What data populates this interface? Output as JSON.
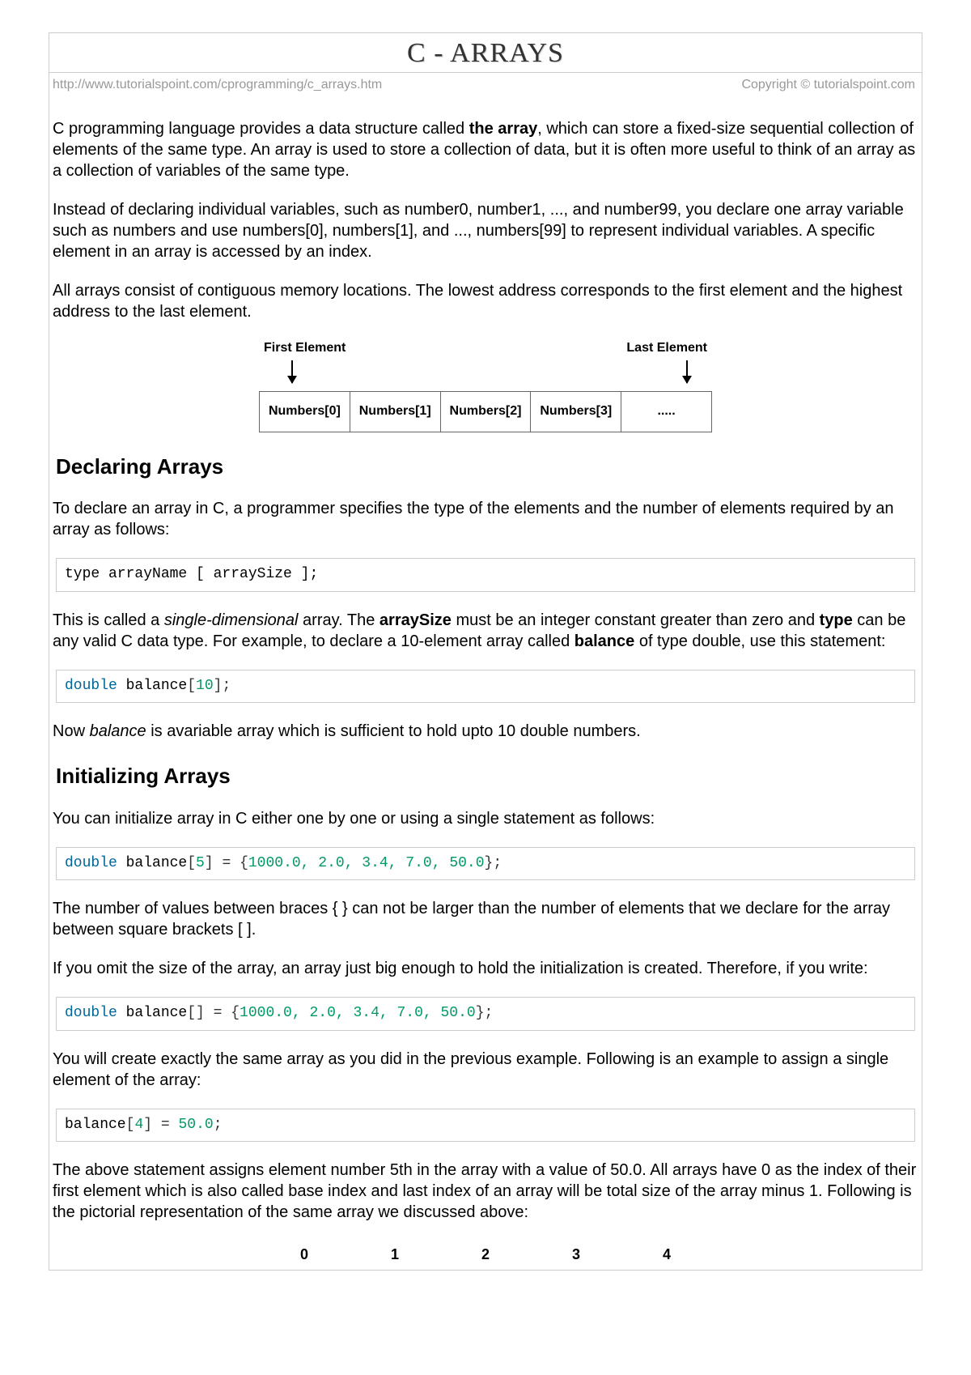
{
  "title": "C - ARRAYS",
  "url": "http://www.tutorialspoint.com/cprogramming/c_arrays.htm",
  "copyright": "Copyright © tutorialspoint.com",
  "para1_a": "C programming language provides a data structure called ",
  "para1_b": "the array",
  "para1_c": ", which can store a fixed-size sequential collection of elements of the same type. An array is used to store a collection of data, but it is often more useful to think of an array as a collection of variables of the same type.",
  "para2": "Instead of declaring individual variables, such as number0, number1, ..., and number99, you declare one array variable such as numbers and use numbers[0], numbers[1], and ..., numbers[99] to represent individual variables. A specific element in an array is accessed by an index.",
  "para3": "All arrays consist of contiguous memory locations. The lowest address corresponds to the first element and the highest address to the last element.",
  "diag1": {
    "first": "First Element",
    "last": "Last Element",
    "cells": [
      "Numbers[0]",
      "Numbers[1]",
      "Numbers[2]",
      "Numbers[3]",
      "....."
    ]
  },
  "h_declaring": "Declaring Arrays",
  "para4": "To declare an array in C, a programmer specifies the type of the elements and the number of elements required by an array as follows:",
  "code1": "type arrayName [ arraySize ];",
  "para5_a": "This is called a ",
  "para5_b": "single-dimensional",
  "para5_c": " array. The ",
  "para5_d": "arraySize",
  "para5_e": " must be an integer constant greater than zero and ",
  "para5_f": "type",
  "para5_g": " can be any valid C data type. For example, to declare a 10-element array called ",
  "para5_h": "balance",
  "para5_i": " of type double, use this statement:",
  "code2_kw": "double",
  "code2_rest": " balance",
  "code2_num": "10",
  "para6_a": "Now ",
  "para6_b": "balance",
  "para6_c": " is avariable array which is sufficient to hold upto 10 double numbers.",
  "h_init": "Initializing Arrays",
  "para7": "You can initialize array in C either one by one or using a single statement as follows:",
  "code3_kw": "double",
  "code3_a": " balance",
  "code3_n1": "5",
  "code3_vals": "1000.0, 2.0, 3.4, 7.0, 50.0",
  "para8": "The number of values between braces { } can not be larger than the number of elements that we declare for the array between square brackets [ ].",
  "para9": "If you omit the size of the array, an array just big enough to hold the initialization is created. Therefore, if you write:",
  "code4_kw": "double",
  "code4_a": " balance",
  "code4_vals": "1000.0, 2.0, 3.4, 7.0, 50.0",
  "para10": "You will create exactly the same array as you did in the previous example. Following is an example to assign a single element of the array:",
  "code5_a": "balance",
  "code5_n1": "4",
  "code5_n2": "50.0",
  "para11": "The above statement assigns element number 5th in the array with a value of 50.0. All arrays have 0 as the index of their first element which is also called base index and last index of an array will be total size of the array minus 1. Following is the pictorial representation of the same array we discussed above:",
  "diag2_indices": [
    "0",
    "1",
    "2",
    "3",
    "4"
  ]
}
